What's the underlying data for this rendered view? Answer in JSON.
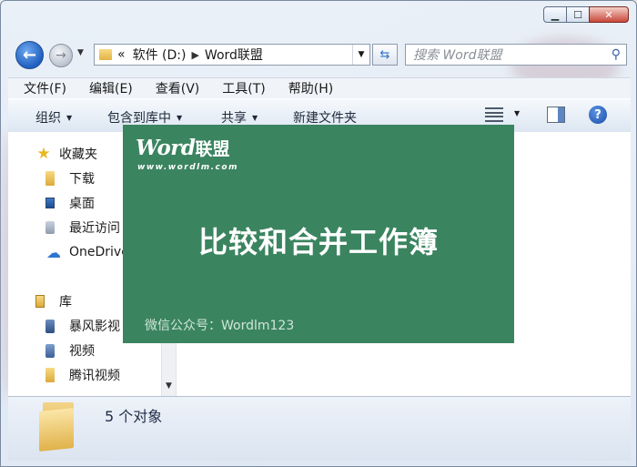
{
  "window": {
    "caption_buttons": [
      "minimize",
      "maximize",
      "close"
    ]
  },
  "nav": {
    "address": {
      "prefix": "«",
      "segments": [
        "软件 (D:)",
        "Word联盟"
      ]
    },
    "search_placeholder": "搜索 Word联盟"
  },
  "menu": [
    "文件(F)",
    "编辑(E)",
    "查看(V)",
    "工具(T)",
    "帮助(H)"
  ],
  "commands": {
    "organize": "组织",
    "include_in_library": "包含到库中",
    "share": "共享",
    "new_folder": "新建文件夹"
  },
  "tree": {
    "favorites": {
      "label": "收藏夹",
      "items": [
        "下载",
        "桌面",
        "最近访问",
        "OneDrive"
      ]
    },
    "libraries": {
      "label": "库",
      "items": [
        "暴风影视",
        "视频",
        "腾讯视频"
      ]
    }
  },
  "status": {
    "count": "5 个对象"
  },
  "banner": {
    "logo_word": "Word",
    "logo_cn": "联盟",
    "logo_url": "www.wordlm.com",
    "title": "比较和合并工作簿",
    "wechat": "微信公众号：Wordlm123",
    "color": "#3b8460"
  },
  "colors": {
    "accent": "#2a6fc9",
    "close_button": "#c9473a"
  }
}
